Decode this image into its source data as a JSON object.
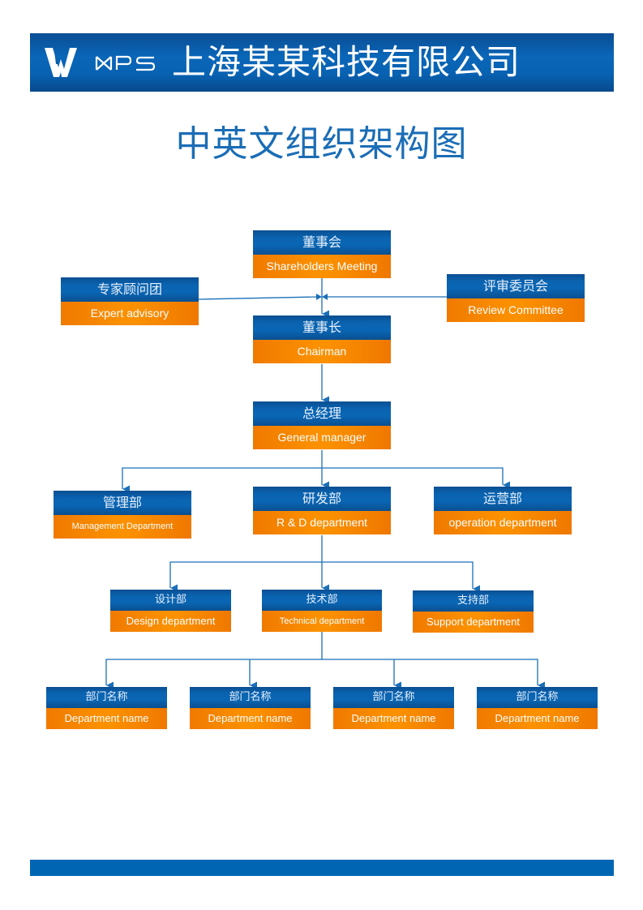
{
  "header": {
    "logo_label": "WPS",
    "company_name": "上海某某科技有限公司",
    "brand_color": "#0a63b0"
  },
  "title": "中英文组织架构图",
  "colors": {
    "node_top": "#0a63b0",
    "node_bottom": "#fb9000",
    "connector": "#1a6fb8",
    "title": "#1b6db6",
    "footer": "#0066b3"
  },
  "nodes": {
    "shareholders": {
      "cn": "董事会",
      "en": "Shareholders Meeting"
    },
    "expert": {
      "cn": "专家顾问团",
      "en": "Expert advisory"
    },
    "review": {
      "cn": "评审委员会",
      "en": "Review Committee"
    },
    "chairman": {
      "cn": "董事长",
      "en": "Chairman"
    },
    "general_manager": {
      "cn": "总经理",
      "en": "General manager"
    },
    "management": {
      "cn": "管理部",
      "en": "Management Department"
    },
    "rnd": {
      "cn": "研发部",
      "en": "R & D department"
    },
    "operation": {
      "cn": "运营部",
      "en": "operation department"
    },
    "design": {
      "cn": "设计部",
      "en": "Design department"
    },
    "technical": {
      "cn": "技术部",
      "en": "Technical department"
    },
    "support": {
      "cn": "支持部",
      "en": "Support department"
    },
    "dept_1": {
      "cn": "部门名称",
      "en": "Department name"
    },
    "dept_2": {
      "cn": "部门名称",
      "en": "Department name"
    },
    "dept_3": {
      "cn": "部门名称",
      "en": "Department name"
    },
    "dept_4": {
      "cn": "部门名称",
      "en": "Department name"
    }
  }
}
